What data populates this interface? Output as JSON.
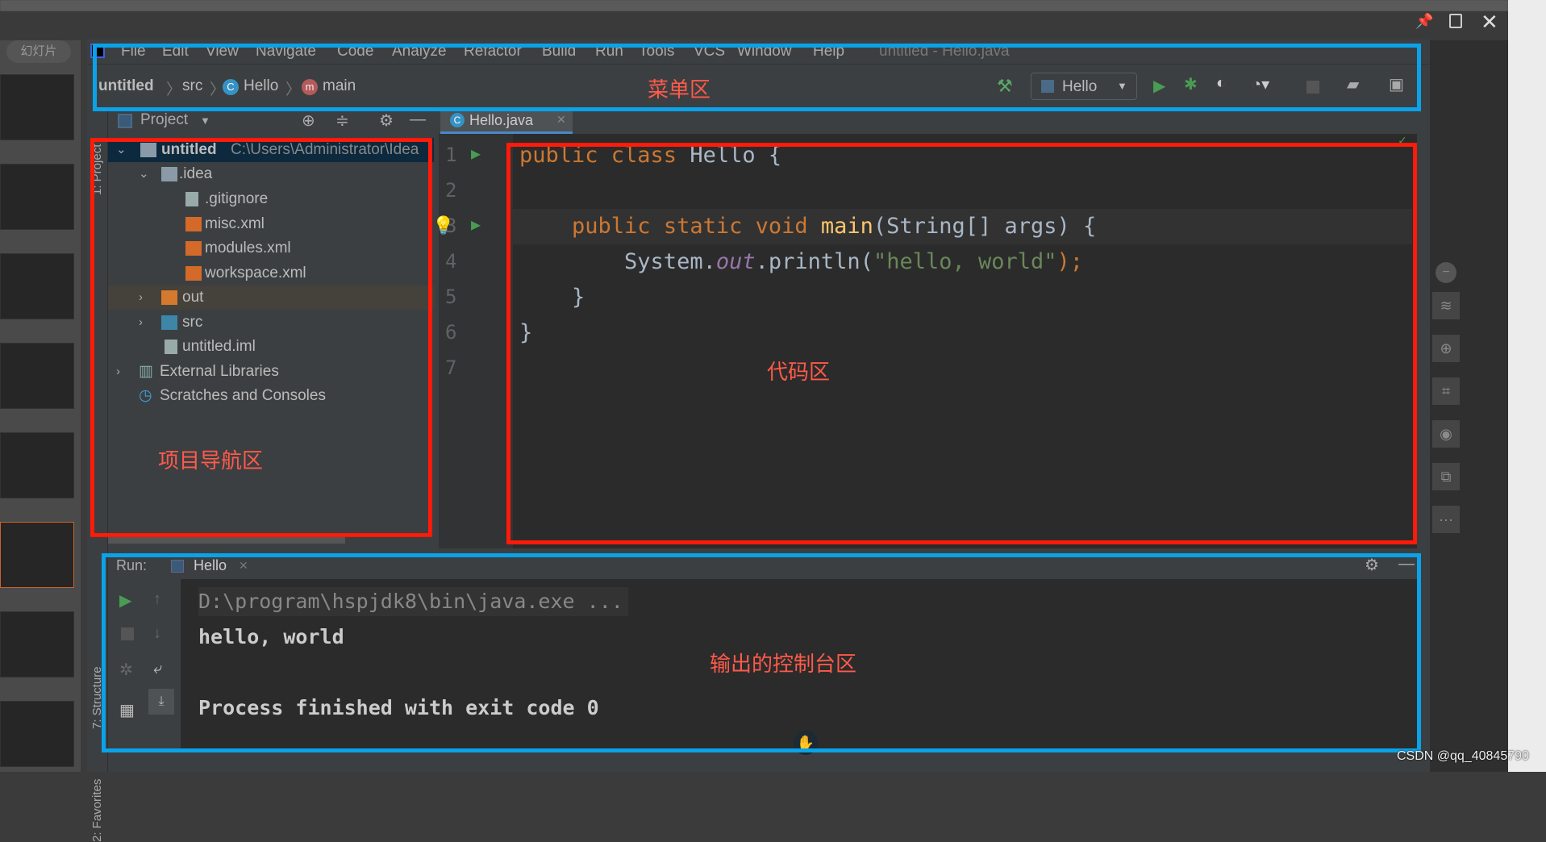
{
  "viewer": {
    "slides_button": "幻灯片",
    "watermark": "CSDN @qq_40845790"
  },
  "menu": {
    "items": [
      "File",
      "Edit",
      "View",
      "Navigate",
      "Code",
      "Analyze",
      "Refactor",
      "Build",
      "Run",
      "Tools",
      "VCS",
      "Window",
      "Help"
    ],
    "window_title": "untitled - Hello.java"
  },
  "breadcrumb": {
    "project": "untitled",
    "folder": "src",
    "class": "Hello",
    "method": "main"
  },
  "toolbar": {
    "run_config": "Hello"
  },
  "project_panel": {
    "title": "Project",
    "side_tab": "1: Project",
    "tree": [
      {
        "label": "untitled",
        "path": "C:\\Users\\Administrator\\Idea"
      },
      {
        "label": ".idea"
      },
      {
        "label": ".gitignore"
      },
      {
        "label": "misc.xml"
      },
      {
        "label": "modules.xml"
      },
      {
        "label": "workspace.xml"
      },
      {
        "label": "out"
      },
      {
        "label": "src"
      },
      {
        "label": "untitled.iml"
      },
      {
        "label": "External Libraries"
      },
      {
        "label": "Scratches and Consoles"
      }
    ]
  },
  "editor": {
    "tab": "Hello.java",
    "line_numbers": [
      "1",
      "2",
      "3",
      "4",
      "5",
      "6",
      "7"
    ],
    "lines": [
      {
        "t": [
          "public class ",
          "Hello {"
        ]
      },
      {
        "t": []
      },
      {
        "t": [
          "    ",
          "public static void ",
          "main",
          "(String[] args) {"
        ]
      },
      {
        "t": [
          "        System.",
          "out",
          ".println(",
          "\"hello, world\"",
          ");"
        ]
      },
      {
        "t": [
          "    }"
        ]
      },
      {
        "t": [
          "}"
        ]
      },
      {
        "t": []
      }
    ]
  },
  "run": {
    "label": "Run:",
    "tab": "Hello",
    "side_tabs": [
      "7: Structure",
      "2: Favorites"
    ],
    "console": [
      "D:\\program\\hspjdk8\\bin\\java.exe ...",
      "hello, world",
      "",
      "Process finished with exit code 0"
    ]
  },
  "annotations": {
    "menu_area": "菜单区",
    "project_area": "项目导航区",
    "code_area": "代码区",
    "console_area": "输出的控制台区"
  },
  "colors": {
    "annotation_red": "#ff1a0a",
    "annotation_blue": "#0aa2e8",
    "keyword": "#cc7832",
    "method": "#ffc66d",
    "string": "#6a8759",
    "field": "#9876aa"
  }
}
